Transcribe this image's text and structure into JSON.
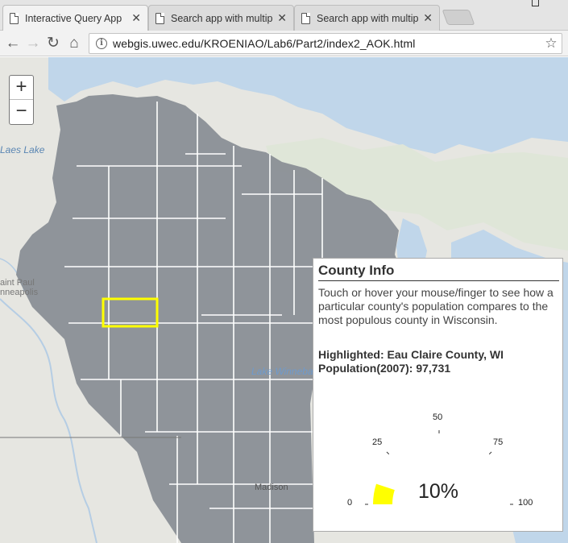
{
  "browser": {
    "tabs": [
      {
        "title": "Interactive Query App",
        "close": "✕"
      },
      {
        "title": "Search app with multip",
        "close": "✕"
      },
      {
        "title": "Search app with multip",
        "close": "✕"
      }
    ],
    "back": "←",
    "forward": "→",
    "reload": "↻",
    "home": "⌂",
    "info": "i",
    "url": "webgis.uwec.edu/KROENIAO/Lab6/Part2/index2_AOK.html",
    "bookmark": "☆"
  },
  "map": {
    "zoom_in": "+",
    "zoom_out": "−",
    "labels": {
      "lake_left": "Laes Lake",
      "city_1": "aint Paul",
      "city_2": "nneapolis",
      "lake_winnebago": "Lake Winnebago",
      "madison": "Madison"
    },
    "colors": {
      "counties": "#8a8f96",
      "highlight": "#ffff00",
      "water": "#c0d6ea",
      "land": "#e6e6e1"
    }
  },
  "info_panel": {
    "title": "County Info",
    "description": "Touch or hover your mouse/finger to see how a particular county's population compares to the most populous county in Wisconsin.",
    "highlighted": "Highlighted: Eau Claire County, WI",
    "population": "Population(2007): 97,731",
    "gauge": {
      "ticks": [
        "0",
        "25",
        "50",
        "75",
        "100"
      ],
      "tick_values": [
        0,
        25,
        50,
        75,
        100
      ],
      "value_percent": 10,
      "display": "10%",
      "fill_color": "#ffff00"
    }
  }
}
